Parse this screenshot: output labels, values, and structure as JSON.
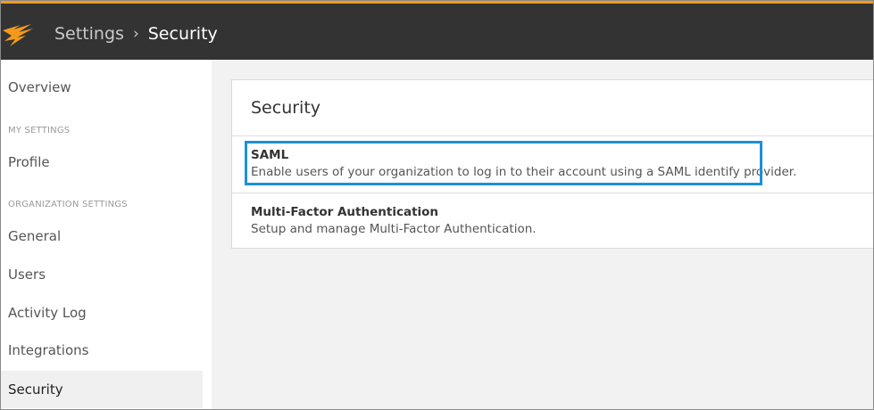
{
  "header": {
    "breadcrumb_parent": "Settings",
    "breadcrumb_separator": "›",
    "breadcrumb_current": "Security",
    "accent_color": "#f39a1d",
    "logo_icon": "flame-logo-icon"
  },
  "sidebar": {
    "overview": "Overview",
    "section_my_settings": "MY SETTINGS",
    "profile": "Profile",
    "section_org_settings": "ORGANIZATION SETTINGS",
    "general": "General",
    "users": "Users",
    "activity_log": "Activity Log",
    "integrations": "Integrations",
    "security": "Security",
    "active_item": "Security"
  },
  "main": {
    "card_title": "Security",
    "items": [
      {
        "title": "SAML",
        "description": "Enable users of your organization to log in to their account using a SAML identify provider."
      },
      {
        "title": "Multi-Factor Authentication",
        "description": "Setup and manage Multi-Factor Authentication."
      }
    ],
    "highlight_color": "#1e90d9"
  }
}
